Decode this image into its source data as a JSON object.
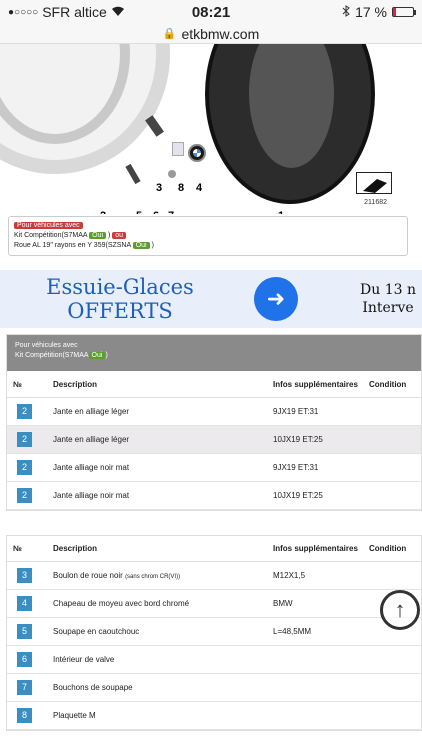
{
  "status_bar": {
    "signal": "●○○○○",
    "carrier": "SFR altice",
    "wifi_icon": "wifi-icon",
    "time": "08:21",
    "bluetooth_icon": "bluetooth-icon",
    "battery": "17 %",
    "battery_level_fraction": 0.17
  },
  "url_bar": {
    "domain": "etkbmw.com"
  },
  "diagram": {
    "labels": [
      "2",
      "3",
      "8",
      "4",
      "5",
      "6",
      "7",
      "1"
    ],
    "ref_number": "211682"
  },
  "note": {
    "title": "Pour véhicules avec",
    "line1_prefix": "Kit Compétition(S7MAA",
    "line1_oui": "Oui",
    "line1_ou": "ou",
    "line2_prefix": "Roue AL 19\" rayons en Y 359(SZSNA",
    "line2_oui": "Oui",
    "line2_suffix": ")"
  },
  "banner": {
    "left_line1": "Essuie-Glaces",
    "left_line2": "OFFERTS",
    "arrow_icon": "arrow-right-icon",
    "right_line1": "Du 13 n",
    "right_line2": "Interve"
  },
  "table1": {
    "header_line1": "Pour véhicules avec",
    "header_line2_prefix": "Kit Compétition(S7MAA",
    "header_line2_oui": "Oui",
    "header_line2_suffix": ")",
    "columns": [
      "№",
      "Description",
      "Infos supplémentaires",
      "Condition"
    ],
    "rows": [
      {
        "n": "2",
        "desc": "Jante en alliage léger",
        "info": "9JX19 ET:31",
        "cond": ""
      },
      {
        "n": "2",
        "desc": "Jante en alliage léger",
        "info": "10JX19 ET:25",
        "cond": ""
      },
      {
        "n": "2",
        "desc": "Jante alliage noir mat",
        "info": "9JX19 ET:31",
        "cond": ""
      },
      {
        "n": "2",
        "desc": "Jante alliage noir mat",
        "info": "10JX19 ET:25",
        "cond": ""
      }
    ]
  },
  "table2": {
    "columns": [
      "№",
      "Description",
      "Infos supplémentaires",
      "Condition"
    ],
    "rows": [
      {
        "n": "3",
        "desc": "Boulon de roue noir",
        "desc_small": "(sans chrom CR(VI))",
        "info": "M12X1,5",
        "cond": ""
      },
      {
        "n": "4",
        "desc": "Chapeau de moyeu avec bord chromé",
        "desc_small": "",
        "info": "BMW",
        "cond": ""
      },
      {
        "n": "5",
        "desc": "Soupape en caoutchouc",
        "desc_small": "",
        "info": "L=48,5MM",
        "cond": ""
      },
      {
        "n": "6",
        "desc": "Intérieur de valve",
        "desc_small": "",
        "info": "",
        "cond": ""
      },
      {
        "n": "7",
        "desc": "Bouchons de soupape",
        "desc_small": "",
        "info": "",
        "cond": ""
      },
      {
        "n": "8",
        "desc": "Plaquette M",
        "desc_small": "",
        "info": "",
        "cond": ""
      }
    ]
  },
  "scroll_top_icon": "arrow-up-circle-icon"
}
